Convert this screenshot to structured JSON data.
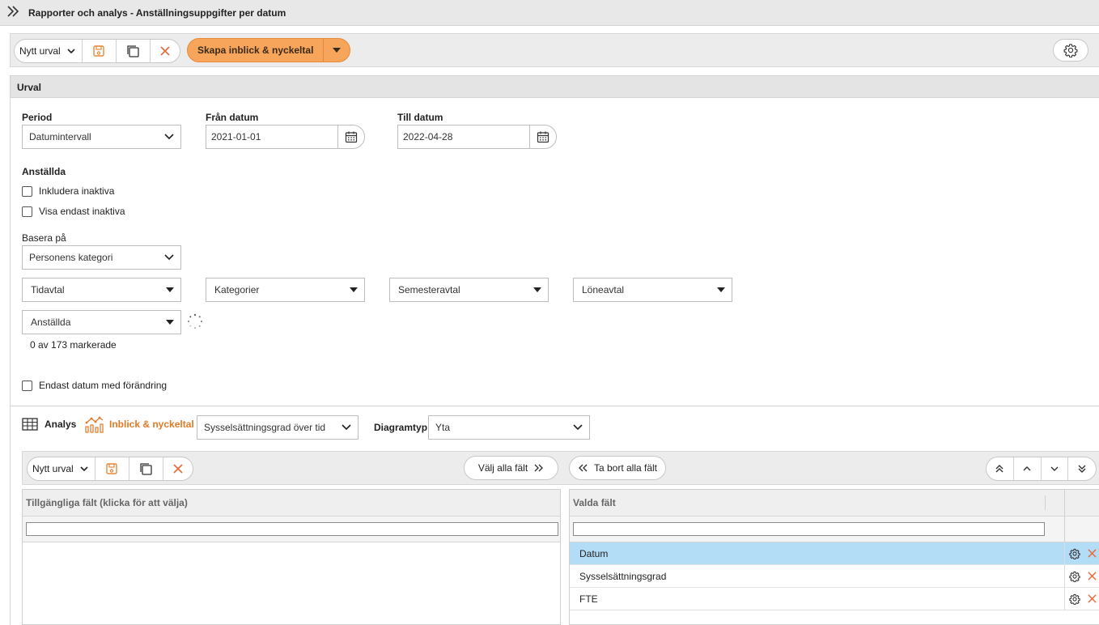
{
  "window": {
    "title": "Rapporter och analys - Anställningsuppgifter per datum"
  },
  "toolbar": {
    "selection_value": "Nytt urval",
    "create_button_label": "Skapa inblick & nyckeltal"
  },
  "section": {
    "title": "Urval"
  },
  "form": {
    "period_label": "Period",
    "period_value": "Datumintervall",
    "from_label": "Från datum",
    "from_value": "2021-01-01",
    "to_label": "Till datum",
    "to_value": "2022-04-28",
    "employees_label": "Anställda",
    "include_inactive_label": "Inkludera inaktiva",
    "only_inactive_label": "Visa endast inaktiva",
    "base_on_label": "Basera på",
    "base_on_value": "Personens kategori",
    "filters": [
      "Tidavtal",
      "Kategorier",
      "Semesteravtal",
      "Löneavtal"
    ],
    "employees_select": "Anställda",
    "marked_count": "0 av 173 markerade",
    "only_changed_label": "Endast datum med förändring"
  },
  "analysis": {
    "tab_analys": "Analys",
    "tab_insight": "Inblick & nyckeltal",
    "insight_value": "Sysselsättningsgrad över tid",
    "diagram_label": "Diagramtyp",
    "diagram_value": "Yta"
  },
  "subtoolbar": {
    "selection_value": "Nytt urval",
    "select_all_label": "Välj alla fält",
    "remove_all_label": "Ta bort alla fält"
  },
  "available": {
    "header": "Tillgängliga fält (klicka för att välja)"
  },
  "selected": {
    "header": "Valda fält",
    "rows": [
      "Datum",
      "Sysselsättningsgrad",
      "FTE"
    ]
  },
  "colors": {
    "accent": "#f7a55b",
    "accent_text": "#e07a26",
    "selected_row": "#b3dcf7",
    "delete": "#e8693a"
  }
}
